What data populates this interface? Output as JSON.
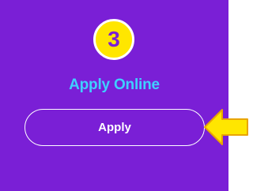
{
  "card": {
    "step_number": "3",
    "title": "Apply Online",
    "button_label": "Apply"
  },
  "colors": {
    "card_background": "#7a1fd6",
    "badge_fill": "#ffe600",
    "title_text": "#3fd0ff",
    "arrow_fill": "#ffe600",
    "arrow_stroke": "#e8a400"
  },
  "icons": {
    "pointer": "arrow-left-icon"
  }
}
